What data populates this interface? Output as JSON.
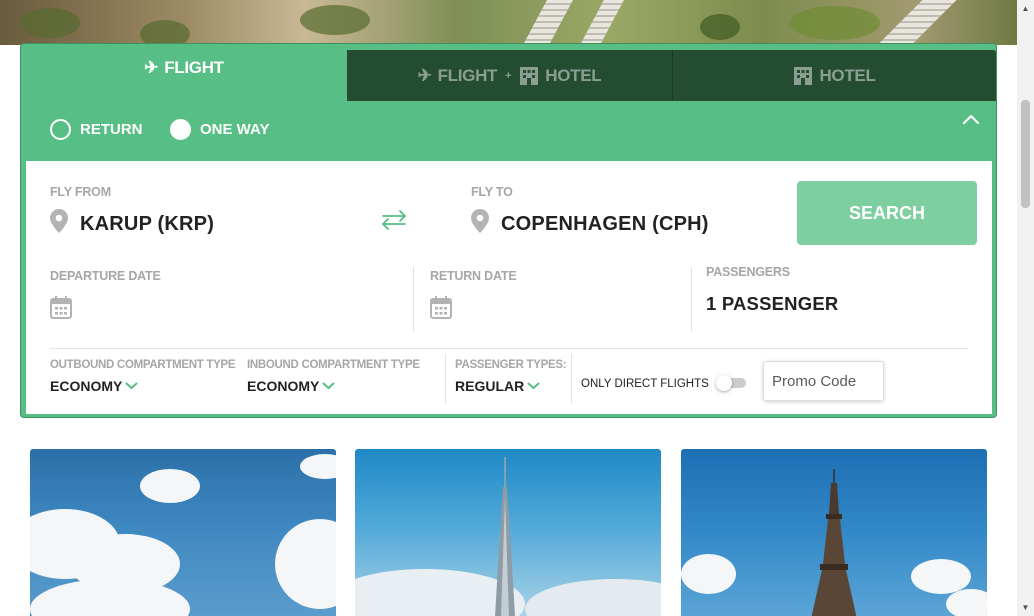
{
  "tabs": [
    {
      "label": "FLIGHT",
      "active": true
    },
    {
      "label_part1": "FLIGHT",
      "label_plus": "+",
      "label_part2": "HOTEL",
      "active": false
    },
    {
      "label": "HOTEL",
      "active": false
    }
  ],
  "trip_type": {
    "options": [
      {
        "label": "RETURN",
        "selected": false
      },
      {
        "label": "ONE WAY",
        "selected": true
      }
    ]
  },
  "fly_from": {
    "label": "FLY FROM",
    "value": "KARUP (KRP)"
  },
  "fly_to": {
    "label": "FLY TO",
    "value": "COPENHAGEN (CPH)"
  },
  "search": {
    "label": "SEARCH"
  },
  "departure_date": {
    "label": "DEPARTURE DATE",
    "value": ""
  },
  "return_date": {
    "label": "RETURN DATE",
    "value": ""
  },
  "passengers": {
    "label": "PASSENGERS",
    "value": "1 PASSENGER"
  },
  "outbound": {
    "label": "OUTBOUND COMPARTMENT TYPE",
    "value": "ECONOMY"
  },
  "inbound": {
    "label": "INBOUND COMPARTMENT TYPE",
    "value": "ECONOMY"
  },
  "passenger_types": {
    "label": "PASSENGER TYPES:",
    "value": "REGULAR"
  },
  "direct_flights": {
    "label": "ONLY DIRECT FLIGHTS",
    "enabled": false
  },
  "promo": {
    "placeholder": "Promo Code"
  },
  "colors": {
    "brand_green": "#57bf85",
    "dark_green": "#234c30",
    "search_button": "#7ecf9f"
  }
}
